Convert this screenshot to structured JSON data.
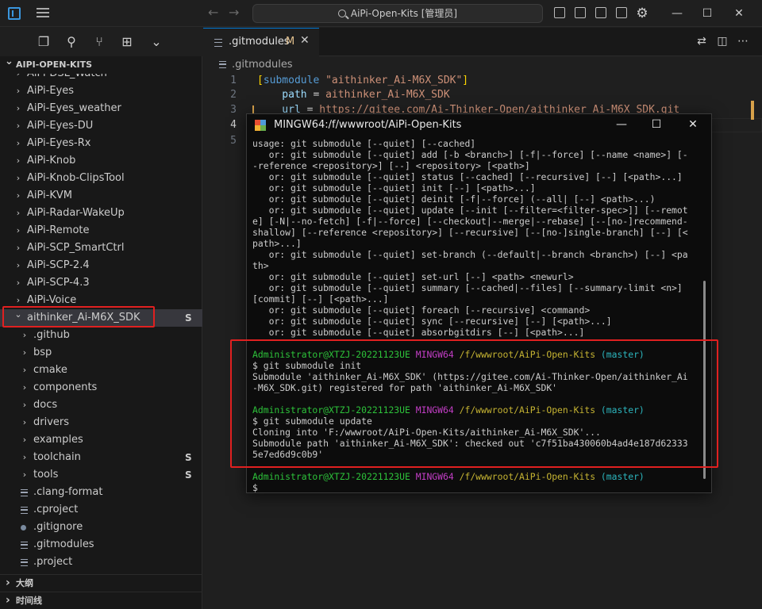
{
  "titlebar": {
    "search_text": "AiPi-Open-Kits [管理员]",
    "back_icon": "arrow-left-icon",
    "forward_icon": "arrow-right-icon",
    "minimize": "—",
    "maximize": "☐",
    "close": "✕"
  },
  "activity": {
    "icons": [
      "files-icon",
      "search-icon",
      "source-control-icon",
      "extensions-icon",
      "chevron-down-icon"
    ]
  },
  "explorer": {
    "title": "AIPI-OPEN-KITS",
    "items": [
      {
        "label": "AiPi-DSL_Watch",
        "type": "folder",
        "depth": 0,
        "status": ""
      },
      {
        "label": "AiPi-Eyes",
        "type": "folder",
        "depth": 0,
        "status": ""
      },
      {
        "label": "AiPi-Eyes_weather",
        "type": "folder",
        "depth": 0,
        "status": ""
      },
      {
        "label": "AiPi-Eyes-DU",
        "type": "folder",
        "depth": 0,
        "status": ""
      },
      {
        "label": "AiPi-Eyes-Rx",
        "type": "folder",
        "depth": 0,
        "status": ""
      },
      {
        "label": "AiPi-Knob",
        "type": "folder",
        "depth": 0,
        "status": ""
      },
      {
        "label": "AiPi-Knob-ClipsTool",
        "type": "folder",
        "depth": 0,
        "status": ""
      },
      {
        "label": "AiPi-KVM",
        "type": "folder",
        "depth": 0,
        "status": ""
      },
      {
        "label": "AiPi-Radar-WakeUp",
        "type": "folder",
        "depth": 0,
        "status": ""
      },
      {
        "label": "AiPi-Remote",
        "type": "folder",
        "depth": 0,
        "status": ""
      },
      {
        "label": "AiPi-SCP_SmartCtrl",
        "type": "folder",
        "depth": 0,
        "status": ""
      },
      {
        "label": "AiPi-SCP-2.4",
        "type": "folder",
        "depth": 0,
        "status": ""
      },
      {
        "label": "AiPi-SCP-4.3",
        "type": "folder",
        "depth": 0,
        "status": ""
      },
      {
        "label": "AiPi-Voice",
        "type": "folder",
        "depth": 0,
        "status": ""
      },
      {
        "label": "aithinker_Ai-M6X_SDK",
        "type": "folder-open",
        "depth": 0,
        "status": "S"
      },
      {
        "label": ".github",
        "type": "folder",
        "depth": 1,
        "status": ""
      },
      {
        "label": "bsp",
        "type": "folder",
        "depth": 1,
        "status": ""
      },
      {
        "label": "cmake",
        "type": "folder",
        "depth": 1,
        "status": ""
      },
      {
        "label": "components",
        "type": "folder",
        "depth": 1,
        "status": ""
      },
      {
        "label": "docs",
        "type": "folder",
        "depth": 1,
        "status": ""
      },
      {
        "label": "drivers",
        "type": "folder",
        "depth": 1,
        "status": ""
      },
      {
        "label": "examples",
        "type": "folder",
        "depth": 1,
        "status": ""
      },
      {
        "label": "toolchain",
        "type": "folder",
        "depth": 1,
        "status": "S"
      },
      {
        "label": "tools",
        "type": "folder",
        "depth": 1,
        "status": "S"
      },
      {
        "label": ".clang-format",
        "type": "file",
        "depth": 1,
        "status": ""
      },
      {
        "label": ".cproject",
        "type": "file",
        "depth": 1,
        "status": ""
      },
      {
        "label": ".gitignore",
        "type": "gitfile",
        "depth": 1,
        "status": ""
      },
      {
        "label": ".gitmodules",
        "type": "file",
        "depth": 1,
        "status": ""
      },
      {
        "label": ".project",
        "type": "file",
        "depth": 1,
        "status": ""
      }
    ],
    "outline_label": "大纲",
    "timeline_label": "时间线"
  },
  "editor": {
    "tab_label": ".gitmodules",
    "tab_modified": "M",
    "tab_close": "✕",
    "breadcrumb": ".gitmodules",
    "line_numbers": [
      "1",
      "2",
      "3",
      "4",
      "5"
    ],
    "lines": {
      "l1_bracket_open": "[",
      "l1_key": "submodule",
      "l1_str": " \"aithinker_Ai-M6X_SDK\"",
      "l1_bracket_close": "]",
      "l2_key": "    path",
      "l2_eq": " = ",
      "l2_val": "aithinker_Ai-M6X_SDK",
      "l3_key": "    url",
      "l3_eq": " = ",
      "l3_val": "https://gitee.com/Ai-Thinker-Open/aithinker_Ai-M6X_SDK.git"
    }
  },
  "terminal": {
    "title": "MINGW64:/f/wwwroot/AiPi-Open-Kits",
    "minimize": "—",
    "maximize": "☐",
    "close": "✕",
    "usage_lines": [
      "usage: git submodule [--quiet] [--cached]",
      "   or: git submodule [--quiet] add [-b <branch>] [-f|--force] [--name <name>] [-",
      "-reference <repository>] [--] <repository> [<path>]",
      "   or: git submodule [--quiet] status [--cached] [--recursive] [--] [<path>...]",
      "   or: git submodule [--quiet] init [--] [<path>...]",
      "   or: git submodule [--quiet] deinit [-f|--force] (--all| [--] <path>...)",
      "   or: git submodule [--quiet] update [--init [--filter=<filter-spec>]] [--remot",
      "e] [-N|--no-fetch] [-f|--force] [--checkout|--merge|--rebase] [--[no-]recommend-",
      "shallow] [--reference <repository>] [--recursive] [--[no-]single-branch] [--] [<",
      "path>...]",
      "   or: git submodule [--quiet] set-branch (--default|--branch <branch>) [--] <pa",
      "th>",
      "   or: git submodule [--quiet] set-url [--] <path> <newurl>",
      "   or: git submodule [--quiet] summary [--cached|--files] [--summary-limit <n>]",
      "[commit] [--] [<path>...]",
      "   or: git submodule [--quiet] foreach [--recursive] <command>",
      "   or: git submodule [--quiet] sync [--recursive] [--] [<path>...]",
      "   or: git submodule [--quiet] absorbgitdirs [--] [<path>...]"
    ],
    "prompt_user": "Administrator@XTZJ-20221123UE",
    "prompt_env": "MINGW64",
    "prompt_path": "/f/wwwroot/AiPi-Open-Kits",
    "prompt_branch": "(master)",
    "cmd1": "$ git submodule init",
    "out1a": "Submodule 'aithinker_Ai-M6X_SDK' (https://gitee.com/Ai-Thinker-Open/aithinker_Ai",
    "out1b": "-M6X_SDK.git) registered for path 'aithinker_Ai-M6X_SDK'",
    "cmd2": "$ git submodule update",
    "out2a": "Cloning into 'F:/wwwroot/AiPi-Open-Kits/aithinker_Ai-M6X_SDK'...",
    "out2b": "Submodule path 'aithinker_Ai-M6X_SDK': checked out 'c7f51ba430060b4ad4e187d62333",
    "out2c": "5e7ed6d9c0b9'",
    "final_prompt": "$"
  },
  "colors": {
    "accent": "#0078d4",
    "highlight_box": "#e02020",
    "term_green": "#2dc23a",
    "term_magenta": "#c33ec6",
    "term_yellow": "#c5b332",
    "term_cyan": "#2cb5bd"
  }
}
